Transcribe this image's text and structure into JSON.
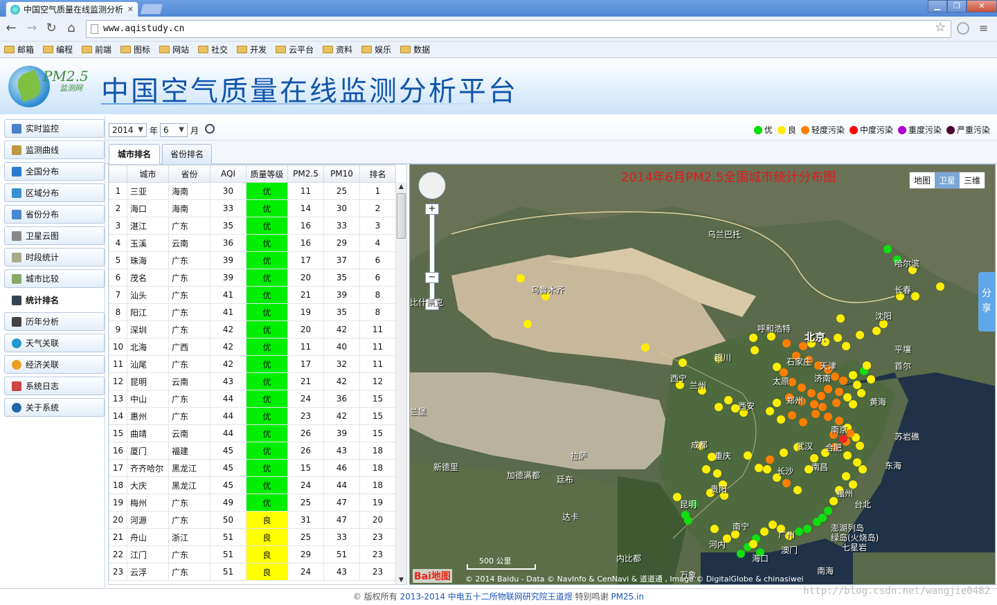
{
  "browser": {
    "tab_title": "中国空气质量在线监测分析",
    "url": "www.aqistudy.cn",
    "bookmarks": [
      "邮箱",
      "编程",
      "前端",
      "图标",
      "网站",
      "社交",
      "开发",
      "云平台",
      "资料",
      "娱乐",
      "数据"
    ]
  },
  "header": {
    "logo_text": "PM2.5",
    "logo_sub": "监测网",
    "title": "中国空气质量在线监测分析平台"
  },
  "sidebar": {
    "items": [
      {
        "label": "实时监控",
        "icon": "monitor-icon"
      },
      {
        "label": "监测曲线",
        "icon": "chart-icon"
      },
      {
        "label": "全国分布",
        "icon": "map-icon"
      },
      {
        "label": "区域分布",
        "icon": "region-icon"
      },
      {
        "label": "省份分布",
        "icon": "province-icon"
      },
      {
        "label": "卫星云图",
        "icon": "satellite-icon"
      },
      {
        "label": "时段统计",
        "icon": "clock-icon"
      },
      {
        "label": "城市比较",
        "icon": "compare-icon"
      },
      {
        "label": "统计排名",
        "icon": "ranking-icon"
      },
      {
        "label": "历年分析",
        "icon": "history-icon"
      },
      {
        "label": "天气关联",
        "icon": "weather-icon"
      },
      {
        "label": "经济关联",
        "icon": "economy-icon"
      },
      {
        "label": "系统日志",
        "icon": "log-icon"
      },
      {
        "label": "关于系统",
        "icon": "info-icon"
      }
    ],
    "active_index": 8
  },
  "controls": {
    "year": "2014",
    "year_label": "年",
    "month": "6",
    "month_label": "月"
  },
  "legend": [
    {
      "label": "优",
      "color": "#00dd00"
    },
    {
      "label": "良",
      "color": "#ffee00"
    },
    {
      "label": "轻度污染",
      "color": "#ff7e00"
    },
    {
      "label": "中度污染",
      "color": "#ff0000"
    },
    {
      "label": "重度污染",
      "color": "#b000d0"
    },
    {
      "label": "严重污染",
      "color": "#4c0033"
    }
  ],
  "tabs": [
    "城市排名",
    "省份排名"
  ],
  "table": {
    "headers": [
      "",
      "城市",
      "省份",
      "AQI",
      "质量等级",
      "PM2.5",
      "PM10",
      "排名"
    ],
    "rows": [
      [
        "1",
        "三亚",
        "海南",
        "30",
        "优",
        "11",
        "25",
        "1"
      ],
      [
        "2",
        "海口",
        "海南",
        "33",
        "优",
        "14",
        "30",
        "2"
      ],
      [
        "3",
        "湛江",
        "广东",
        "35",
        "优",
        "16",
        "33",
        "3"
      ],
      [
        "4",
        "玉溪",
        "云南",
        "36",
        "优",
        "16",
        "29",
        "4"
      ],
      [
        "5",
        "珠海",
        "广东",
        "39",
        "优",
        "17",
        "37",
        "6"
      ],
      [
        "6",
        "茂名",
        "广东",
        "39",
        "优",
        "20",
        "35",
        "6"
      ],
      [
        "7",
        "汕头",
        "广东",
        "41",
        "优",
        "21",
        "39",
        "8"
      ],
      [
        "8",
        "阳江",
        "广东",
        "41",
        "优",
        "19",
        "35",
        "8"
      ],
      [
        "9",
        "深圳",
        "广东",
        "42",
        "优",
        "20",
        "42",
        "11"
      ],
      [
        "10",
        "北海",
        "广西",
        "42",
        "优",
        "11",
        "40",
        "11"
      ],
      [
        "11",
        "汕尾",
        "广东",
        "42",
        "优",
        "17",
        "32",
        "11"
      ],
      [
        "12",
        "昆明",
        "云南",
        "43",
        "优",
        "21",
        "42",
        "12"
      ],
      [
        "13",
        "中山",
        "广东",
        "44",
        "优",
        "24",
        "36",
        "15"
      ],
      [
        "14",
        "惠州",
        "广东",
        "44",
        "优",
        "23",
        "42",
        "15"
      ],
      [
        "15",
        "曲靖",
        "云南",
        "44",
        "优",
        "26",
        "39",
        "15"
      ],
      [
        "16",
        "厦门",
        "福建",
        "45",
        "优",
        "26",
        "43",
        "18"
      ],
      [
        "17",
        "齐齐哈尔",
        "黑龙江",
        "45",
        "优",
        "15",
        "46",
        "18"
      ],
      [
        "18",
        "大庆",
        "黑龙江",
        "45",
        "优",
        "24",
        "44",
        "18"
      ],
      [
        "19",
        "梅州",
        "广东",
        "49",
        "优",
        "25",
        "47",
        "19"
      ],
      [
        "20",
        "河源",
        "广东",
        "50",
        "良",
        "31",
        "47",
        "20"
      ],
      [
        "21",
        "舟山",
        "浙江",
        "51",
        "良",
        "25",
        "33",
        "23"
      ],
      [
        "22",
        "江门",
        "广东",
        "51",
        "良",
        "29",
        "51",
        "23"
      ],
      [
        "23",
        "云浮",
        "广东",
        "51",
        "良",
        "24",
        "43",
        "23"
      ]
    ],
    "level_colors": {
      "优": "#00ee00",
      "良": "#ffff00"
    }
  },
  "map": {
    "title": "2014年6月PM2.5全国城市统计分布图",
    "modes": [
      "地图",
      "卫星",
      "三维"
    ],
    "active_mode": "卫星",
    "scale_label": "500 公里",
    "logo": "Bai地图",
    "copyright": "© 2014 Baidu - Data © NavInfo & CenNavi & 道道通 , Image © DigitalGlobe & chinasiwei",
    "share_label": "分享",
    "labels": [
      "乌兰巴托",
      "乌鲁木齐",
      "哈尔滨",
      "长春",
      "沈阳",
      "呼和浩特",
      "北京",
      "银川",
      "西宁",
      "兰州",
      "石家庄",
      "天津",
      "太原",
      "济南",
      "郑州",
      "西安",
      "南京",
      "武汉",
      "合肥",
      "苏岩礁",
      "成都",
      "重庆",
      "长沙",
      "南昌",
      "拉萨",
      "新德里",
      "加德满都",
      "廷布",
      "达卡",
      "贵阳",
      "昆明",
      "福州",
      "台北",
      "南宁",
      "广州",
      "澎湖列岛",
      "绿岛(火烧岛)",
      "七星岩",
      "河内",
      "海口",
      "澳门",
      "内比都",
      "万象",
      "平壤",
      "首尔",
      "黄海",
      "东海",
      "南海",
      "比什凯克",
      "兰堡"
    ]
  },
  "footer": {
    "text1": "© 版权所有",
    "text2": "2013-2014 中电五十二所物联网研究院王道煜",
    "text3": "特别鸣谢",
    "text4": "PM25.in",
    "watermark": "http://blog.csdn.net/wangjie0482"
  }
}
